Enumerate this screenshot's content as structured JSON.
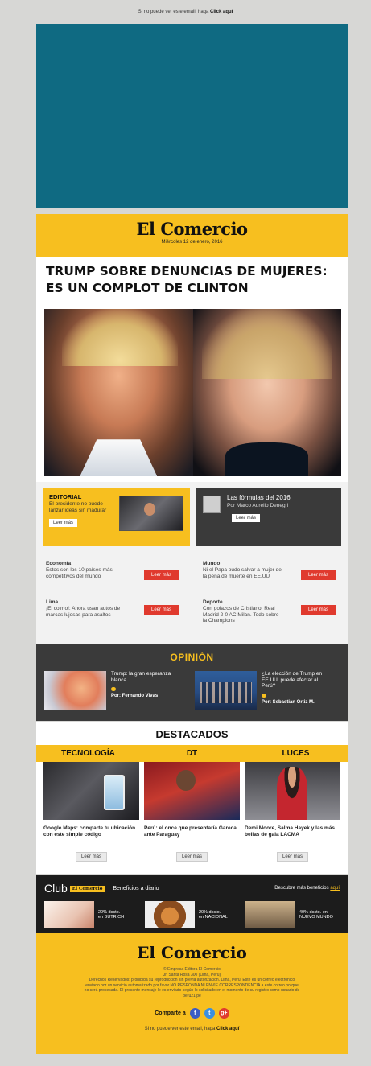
{
  "preheader": {
    "text": "Si no puede ver este email, haga ",
    "link": "Click aquí"
  },
  "masthead": {
    "logo": "El Comercio",
    "date": "Miércoles 12 de enero, 2016"
  },
  "headline": {
    "line1": "TRUMP SOBRE DENUNCIAS DE MUJERES:",
    "line2": "ES UN COMPLOT DE CLINTON"
  },
  "editorial": {
    "label": "EDITORIAL",
    "text": "El presidente no puede lanzar ideas sin madurar",
    "button": "Leer más"
  },
  "column": {
    "title": "Las fórmulas del 2016",
    "author": "Por Marco Aurelio Denegri",
    "button": "Leer más"
  },
  "sections": {
    "left": [
      {
        "heading": "Economía",
        "text": "Estos son los 10 países más competitivos del mundo",
        "button": "Leer más"
      },
      {
        "heading": "Lima",
        "text": "¡El colmo!: Ahora usan autos de marcas lujosas para asaltos",
        "button": "Leer más"
      }
    ],
    "right": [
      {
        "heading": "Mundo",
        "text": "Ni el Papa pudo salvar a mujer de la pena de muerte en EE.UU",
        "button": "Leer más"
      },
      {
        "heading": "Deporte",
        "text": "Con golazos de Cristiano: Real Madrid 2-0 AC Milan. Todo sobre la Champions",
        "button": "Leer más"
      }
    ]
  },
  "opinion": {
    "title": "OPINIÓN",
    "items": [
      {
        "text": "Trump: la gran esperanza blanca",
        "author": "Por: Fernando Vivas"
      },
      {
        "text": "¿La elección de Trump en EE.UU. puede afectar al Perú?",
        "author": "Por: Sebastian Ortiz M."
      }
    ]
  },
  "destacados": {
    "title": "DESTACADOS",
    "items": [
      {
        "category": "TECNOLOGÍA",
        "caption": "Google Maps: comparte tu ubicación con este simple código",
        "button": "Leer más"
      },
      {
        "category": "DT",
        "caption": "Perú: el once que presentaría Gareca ante Paraguay",
        "button": "Leer más"
      },
      {
        "category": "LUCES",
        "caption": "Demi Moore, Salma Hayek y las más bellas de gala LACMA",
        "button": "Leer más"
      }
    ]
  },
  "club": {
    "word": "Club",
    "badge": "El Comercio",
    "subtitle": "Beneficios a diario",
    "more_text": "Descubre más beneficios ",
    "more_link": "aquí",
    "offers": [
      {
        "line1": "20% dscto.",
        "line2": "en BUTRICH"
      },
      {
        "line1": "20% dscto.",
        "line2": "en NACIONAL"
      },
      {
        "line1": "40% dscto. en",
        "line2": "NUEVO MUNDO"
      }
    ]
  },
  "footer": {
    "logo": "El Comercio",
    "legal1": "© Empresa Editora El Comercio",
    "legal2": "Jr. Santa Rosa 300 (Lima, Perú)",
    "legal3": "Derechos Reservados: prohibida su reproducción sin previa autorización. Lima, Perú. Este es un correo electrónico enviado por un servicio automatizado por favor NO RESPONDA NI ENVIE CORRESPONDENCIA a este correo porque no será procesada. El presente mensaje le es enviado según lo solicitado en el momento de su registro como usuario de peru21.pe",
    "share_label": "Comparte a",
    "link_text": "Si no puede ver este email, haga ",
    "link": "Click aquí"
  },
  "icons": [
    "facebook-icon",
    "twitter-icon",
    "google-plus-icon",
    "comment-icon"
  ],
  "colors": {
    "accent": "#f7bf1f",
    "dark": "#3a3a3a",
    "banner": "#0f6a82",
    "button_red": "#e03a2e"
  }
}
